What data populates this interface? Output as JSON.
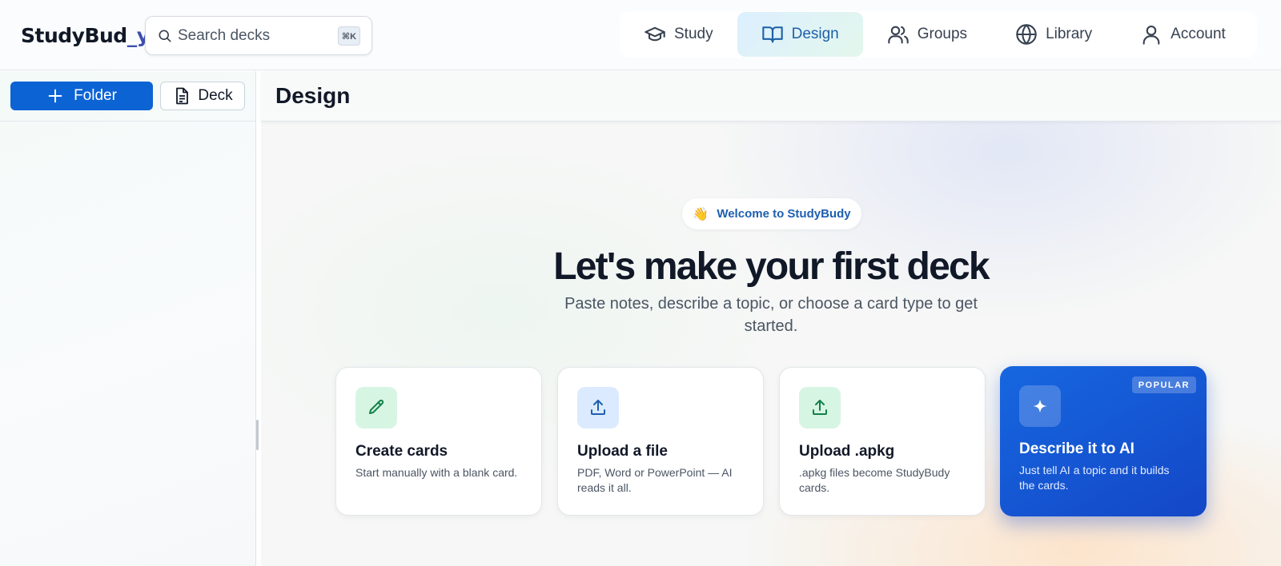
{
  "app": {
    "logo_part1": "StudyBud",
    "logo_part2": "_y"
  },
  "search": {
    "placeholder": "Search decks",
    "shortcut": "⌘K"
  },
  "nav": {
    "items": [
      {
        "label": "Study",
        "icon": "graduation-cap-icon",
        "active": false
      },
      {
        "label": "Design",
        "icon": "open-book-icon",
        "active": true
      },
      {
        "label": "Groups",
        "icon": "users-icon",
        "active": false
      },
      {
        "label": "Library",
        "icon": "globe-icon",
        "active": false
      },
      {
        "label": "Account",
        "icon": "user-icon",
        "active": false
      }
    ]
  },
  "sidebar": {
    "folder_button": "Folder",
    "deck_button": "Deck"
  },
  "main": {
    "title": "Design",
    "welcome": {
      "emoji": "👋",
      "text": "Welcome to StudyBudy"
    },
    "hero_title": "Let's make your first deck",
    "hero_subtitle": "Paste notes, describe a topic, or choose a card type to get started.",
    "cards": [
      {
        "title": "Create cards",
        "description": "Start manually with a blank card.",
        "icon": "pencil-icon"
      },
      {
        "title": "Upload a file",
        "description": "PDF, Word or PowerPoint — AI reads it all.",
        "icon": "upload-icon"
      },
      {
        "title": "Upload .apkg",
        "description": ".apkg files become StudyBudy cards.",
        "icon": "upload-icon"
      },
      {
        "title": "Describe it to AI",
        "description": "Just tell AI a topic and it builds the cards.",
        "icon": "sparkle-icon",
        "badge": "POPULAR"
      }
    ]
  },
  "colors": {
    "accent": "#0c63d4",
    "ai_card": "#1550d0",
    "active_nav_text": "#1d5fa8",
    "logo_blue": "#3d4fb0"
  }
}
